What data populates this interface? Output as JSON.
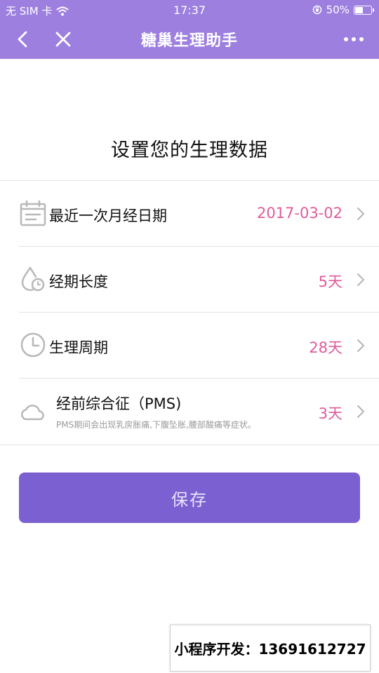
{
  "status_bar": {
    "carrier": "无 SIM 卡",
    "time": "17:37",
    "battery_text": "50%",
    "battery_level": 0.5
  },
  "nav": {
    "title": "糖巢生理助手",
    "back_icon": "back-arrow-icon",
    "close_icon": "close-icon",
    "more_icon": "more-dots-icon"
  },
  "page_title": "设置您的生理数据",
  "settings": [
    {
      "icon": "calendar-icon",
      "label": "最近一次月经日期",
      "value": "2017-03-02"
    },
    {
      "icon": "drop-clock-icon",
      "label": "经期长度",
      "value": "5天"
    },
    {
      "icon": "clock-icon",
      "label": "生理周期",
      "value": "28天"
    },
    {
      "icon": "cloud-icon",
      "label": "经前综合征（PMS)",
      "subtitle": "PMS期间会出现乳房胀痛,下腹坠胀,腰部酸痛等症状。",
      "value": "3天"
    }
  ],
  "save_label": "保存",
  "watermark": "小程序开发：13691612727",
  "colors": {
    "header": "#9d7fe0",
    "accent_value": "#e05b9b",
    "button": "#7b60d2"
  }
}
